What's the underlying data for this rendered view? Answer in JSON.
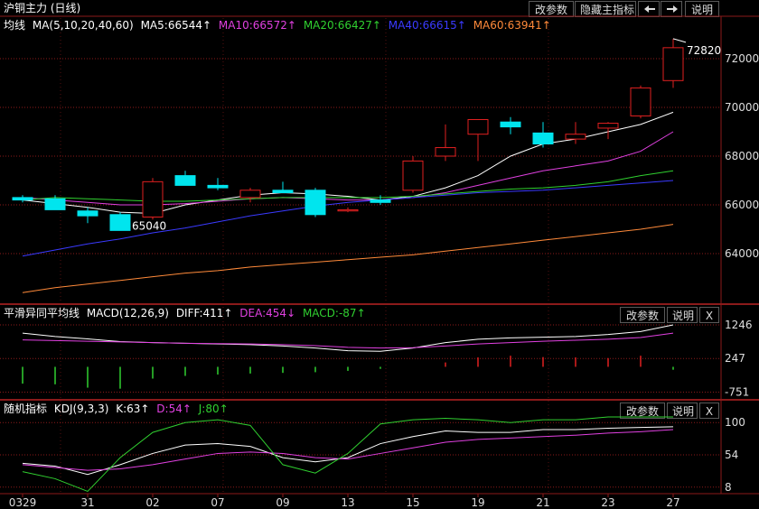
{
  "title": "沪铜主力 (日线)",
  "toolbar": {
    "change_params": "改参数",
    "hide_main_indicator": "隐藏主指标",
    "prev_icon": "arrow-left-icon",
    "next_icon": "arrow-right-icon",
    "help": "说明"
  },
  "panels": {
    "main": {
      "indicator_name": "均线",
      "params": "MA(5,10,20,40,60)",
      "items": [
        {
          "text": "MA5:66544↑",
          "color": "#ffffff"
        },
        {
          "text": "MA10:66572↑",
          "color": "#e040e0"
        },
        {
          "text": "MA20:66427↑",
          "color": "#30d030"
        },
        {
          "text": "MA40:66615↑",
          "color": "#3a3aff"
        },
        {
          "text": "MA60:63941↑",
          "color": "#ff8a3a"
        }
      ],
      "max_label": "72820",
      "min_label": "65040"
    },
    "macd": {
      "indicator_name": "平滑异同平均线",
      "params": "MACD(12,26,9)",
      "items": [
        {
          "text": "DIFF:411↑",
          "color": "#ffffff"
        },
        {
          "text": "DEA:454↓",
          "color": "#e040e0"
        },
        {
          "text": "MACD:-87↑",
          "color": "#30d030"
        }
      ],
      "change_params": "改参数",
      "help": "说明",
      "close": "X",
      "y_ticks": [
        "1246",
        "247",
        "-751"
      ]
    },
    "kdj": {
      "indicator_name": "随机指标",
      "params": "KDJ(9,3,3)",
      "items": [
        {
          "text": "K:63↑",
          "color": "#ffffff"
        },
        {
          "text": "D:54↑",
          "color": "#e040e0"
        },
        {
          "text": "J:80↑",
          "color": "#30d030"
        }
      ],
      "change_params": "改参数",
      "help": "说明",
      "close": "X",
      "y_ticks": [
        "100",
        "54",
        "8"
      ]
    }
  },
  "x_labels": [
    "0329",
    "31",
    "02",
    "07",
    "09",
    "13",
    "15",
    "19",
    "21",
    "23",
    "27"
  ],
  "colors": {
    "background": "#000000",
    "up": "#e02020",
    "down": "#00e5ee",
    "grid": "#8b1a1a",
    "ma5": "#ffffff",
    "ma10": "#e040e0",
    "ma20": "#30d030",
    "ma40": "#3a3aff",
    "ma60": "#ff8a3a"
  },
  "chart_data": [
    {
      "type": "candlestick",
      "title": "沪铜主力 (日线)",
      "y_ticks": [
        64000,
        66000,
        68000,
        70000,
        72000
      ],
      "ylim": [
        62000,
        73000
      ],
      "candles": [
        {
          "o": 66300,
          "h": 66400,
          "l": 66100,
          "c": 66200
        },
        {
          "o": 66250,
          "h": 66400,
          "l": 65800,
          "c": 65800
        },
        {
          "o": 65750,
          "h": 65900,
          "l": 65250,
          "c": 65550
        },
        {
          "o": 65600,
          "h": 65700,
          "l": 64950,
          "c": 64950
        },
        {
          "o": 65500,
          "h": 67100,
          "l": 65400,
          "c": 66950
        },
        {
          "o": 67200,
          "h": 67400,
          "l": 66800,
          "c": 66800
        },
        {
          "o": 66800,
          "h": 67100,
          "l": 66600,
          "c": 66700
        },
        {
          "o": 66300,
          "h": 66700,
          "l": 66100,
          "c": 66600
        },
        {
          "o": 66600,
          "h": 66950,
          "l": 66500,
          "c": 66500
        },
        {
          "o": 66600,
          "h": 66700,
          "l": 65500,
          "c": 65600
        },
        {
          "o": 65750,
          "h": 65900,
          "l": 65700,
          "c": 65800
        },
        {
          "o": 66200,
          "h": 66400,
          "l": 66000,
          "c": 66100
        },
        {
          "o": 66600,
          "h": 68000,
          "l": 66500,
          "c": 67800
        },
        {
          "o": 68000,
          "h": 69300,
          "l": 67800,
          "c": 68350
        },
        {
          "o": 68900,
          "h": 69500,
          "l": 67800,
          "c": 69500
        },
        {
          "o": 69400,
          "h": 69600,
          "l": 68900,
          "c": 69200
        },
        {
          "o": 68950,
          "h": 69400,
          "l": 68350,
          "c": 68500
        },
        {
          "o": 68700,
          "h": 69400,
          "l": 68500,
          "c": 68900
        },
        {
          "o": 69150,
          "h": 69400,
          "l": 68700,
          "c": 69350
        },
        {
          "o": 69650,
          "h": 70900,
          "l": 69550,
          "c": 70800
        },
        {
          "o": 71100,
          "h": 72820,
          "l": 70800,
          "c": 72450
        }
      ],
      "series": [
        {
          "name": "MA5",
          "values": [
            66200,
            66050,
            65900,
            65700,
            65650,
            66000,
            66200,
            66400,
            66500,
            66450,
            66350,
            66200,
            66350,
            66700,
            67200,
            68000,
            68500,
            68700,
            69000,
            69300,
            69800
          ]
        },
        {
          "name": "MA10",
          "values": [
            66300,
            66200,
            66100,
            66000,
            66000,
            66050,
            66150,
            66250,
            66300,
            66250,
            66200,
            66200,
            66300,
            66500,
            66800,
            67100,
            67400,
            67600,
            67800,
            68200,
            69000
          ]
        },
        {
          "name": "MA20",
          "values": [
            66200,
            66300,
            66250,
            66200,
            66150,
            66150,
            66200,
            66250,
            66300,
            66300,
            66300,
            66300,
            66350,
            66450,
            66550,
            66650,
            66700,
            66800,
            66950,
            67200,
            67400
          ]
        },
        {
          "name": "MA40",
          "values": [
            63900,
            64150,
            64400,
            64600,
            64850,
            65050,
            65300,
            65550,
            65750,
            65950,
            66100,
            66200,
            66300,
            66400,
            66500,
            66550,
            66600,
            66700,
            66800,
            66900,
            67000
          ]
        },
        {
          "name": "MA60",
          "values": [
            62400,
            62600,
            62750,
            62900,
            63050,
            63200,
            63300,
            63450,
            63550,
            63650,
            63750,
            63850,
            63950,
            64100,
            64250,
            64400,
            64550,
            64700,
            64850,
            65000,
            65200
          ]
        }
      ],
      "annotations": [
        {
          "text": "72820",
          "kind": "max"
        },
        {
          "text": "65040",
          "kind": "min"
        }
      ]
    },
    {
      "type": "bar+line",
      "title": "MACD(12,26,9)",
      "y_ticks": [
        1246,
        247,
        -751
      ],
      "ylim": [
        -900,
        1300
      ],
      "series": [
        {
          "name": "DIFF",
          "values": [
            1000,
            900,
            830,
            750,
            720,
            700,
            680,
            660,
            620,
            560,
            480,
            460,
            560,
            720,
            820,
            860,
            880,
            900,
            960,
            1050,
            1246
          ]
        },
        {
          "name": "DEA",
          "values": [
            800,
            780,
            760,
            740,
            720,
            700,
            690,
            680,
            660,
            630,
            580,
            560,
            570,
            620,
            680,
            720,
            760,
            790,
            820,
            870,
            1000
          ]
        },
        {
          "name": "MACD",
          "values": [
            -500,
            -520,
            -620,
            -650,
            -350,
            -270,
            -230,
            -200,
            -180,
            -160,
            -120,
            -60,
            0,
            130,
            280,
            330,
            290,
            280,
            260,
            330,
            -87
          ]
        }
      ]
    },
    {
      "type": "line",
      "title": "KDJ(9,3,3)",
      "y_ticks": [
        100,
        54,
        8
      ],
      "ylim": [
        0,
        108
      ],
      "series": [
        {
          "name": "K",
          "values": [
            42,
            38,
            26,
            40,
            56,
            68,
            70,
            66,
            50,
            44,
            50,
            70,
            80,
            88,
            86,
            86,
            90,
            90,
            92,
            93,
            94
          ]
        },
        {
          "name": "D",
          "values": [
            40,
            36,
            32,
            34,
            40,
            48,
            56,
            58,
            56,
            50,
            48,
            56,
            64,
            72,
            76,
            78,
            80,
            82,
            85,
            87,
            90
          ]
        },
        {
          "name": "J",
          "values": [
            30,
            20,
            2,
            50,
            86,
            100,
            104,
            96,
            40,
            28,
            56,
            98,
            104,
            106,
            104,
            100,
            104,
            104,
            108,
            108,
            108
          ]
        }
      ]
    }
  ]
}
